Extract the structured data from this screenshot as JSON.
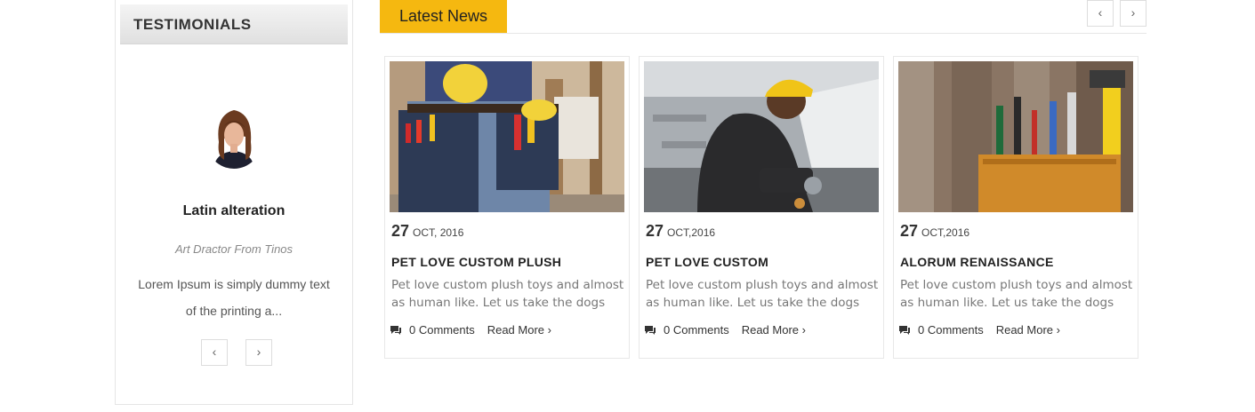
{
  "testimonials": {
    "heading": "TESTIMONIALS",
    "name": "Latin alteration",
    "role": "Art Dractor From Tinos",
    "quote": "Lorem Ipsum is simply dummy text of the printing a...",
    "prev_icon": "chevron-left-icon",
    "next_icon": "chevron-right-icon"
  },
  "news": {
    "tab_label": "Latest News",
    "accent_color": "#f5b810",
    "prev_icon": "chevron-left-icon",
    "next_icon": "chevron-right-icon",
    "cards": [
      {
        "day": "27",
        "month": "OCT, 2016",
        "title": "PET LOVE CUSTOM PLUSH",
        "excerpt": "Pet love custom plush toys and almost as human like. Let us take the dogs a...",
        "comments": "0 Comments",
        "read_more": "Read More ›",
        "image": "worker-tool-belt-photo"
      },
      {
        "day": "27",
        "month": "OCT,2016",
        "title": "PET LOVE CUSTOM",
        "excerpt": "Pet love custom plush toys and almost as human like. Let us take the dogs a...",
        "comments": "0 Comments",
        "read_more": "Read More ›",
        "image": "worker-angle-grinder-photo"
      },
      {
        "day": "27",
        "month": "OCT,2016",
        "title": "ALORUM RENAISSANCE",
        "excerpt": "Pet love custom plush toys and almost as human like. Let us take the dogs a...",
        "comments": "0 Comments",
        "read_more": "Read More ›",
        "image": "tool-bag-on-wood-photo"
      }
    ]
  }
}
